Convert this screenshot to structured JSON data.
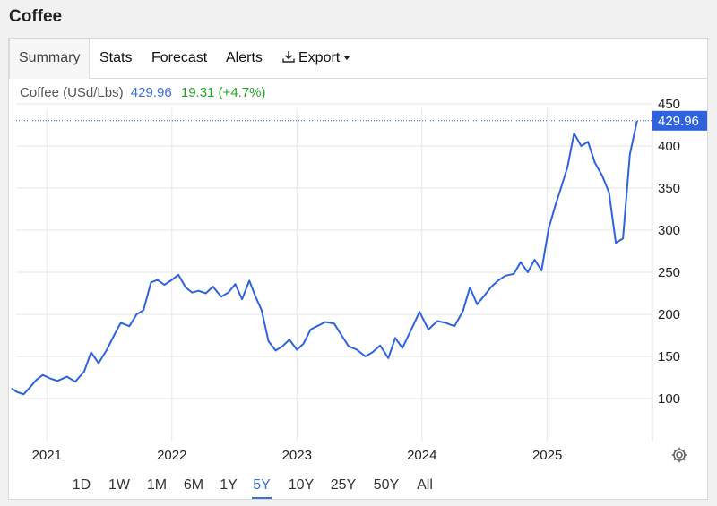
{
  "page": {
    "title": "Coffee"
  },
  "tabs": [
    {
      "label": "Summary",
      "active": true
    },
    {
      "label": "Stats"
    },
    {
      "label": "Forecast"
    },
    {
      "label": "Alerts"
    },
    {
      "label": "Export",
      "icon": "download-icon",
      "dropdown": true
    }
  ],
  "header": {
    "label": "Coffee (USd/Lbs)",
    "price": "429.96",
    "change": "19.31 (+4.7%)"
  },
  "ranges": [
    {
      "label": "1D"
    },
    {
      "label": "1W"
    },
    {
      "label": "1M"
    },
    {
      "label": "6M"
    },
    {
      "label": "1Y"
    },
    {
      "label": "5Y",
      "active": true
    },
    {
      "label": "10Y"
    },
    {
      "label": "25Y"
    },
    {
      "label": "50Y"
    },
    {
      "label": "All"
    }
  ],
  "colors": {
    "line": "#2f63de",
    "price_tag": "#2f63de",
    "change_positive": "#23a323",
    "grid": "#e6e6e6"
  },
  "settings_icon": "gear-icon",
  "chart_data": {
    "type": "line",
    "title": "",
    "xlabel": "",
    "ylabel": "",
    "x_ticks": [
      "2021",
      "2022",
      "2023",
      "2024",
      "2025"
    ],
    "y_ticks": [
      100,
      150,
      200,
      250,
      300,
      350,
      400,
      450
    ],
    "ylim": [
      50,
      455
    ],
    "xlim": [
      "2020-09-15",
      "2025-10-01"
    ],
    "grid": true,
    "last_value": "429.96",
    "series": [
      {
        "x": [
          "2020-09-20",
          "2020-10-05",
          "2020-10-25",
          "2020-11-10",
          "2020-12-01",
          "2020-12-20",
          "2021-01-10",
          "2021-02-01",
          "2021-03-01",
          "2021-03-25",
          "2021-04-20",
          "2021-05-10",
          "2021-06-01",
          "2021-06-25",
          "2021-07-20",
          "2021-08-05",
          "2021-08-30",
          "2021-09-20",
          "2021-10-10",
          "2021-11-01",
          "2021-11-20",
          "2021-12-10",
          "2022-01-01",
          "2022-01-20",
          "2022-02-10",
          "2022-03-01",
          "2022-03-20",
          "2022-04-10",
          "2022-05-01",
          "2022-05-25",
          "2022-06-15",
          "2022-07-05",
          "2022-07-25",
          "2022-08-15",
          "2022-09-01",
          "2022-09-20",
          "2022-10-10",
          "2022-10-31",
          "2022-11-20",
          "2022-12-10",
          "2023-01-01",
          "2023-01-20",
          "2023-02-10",
          "2023-03-01",
          "2023-03-25",
          "2023-04-20",
          "2023-05-10",
          "2023-06-01",
          "2023-06-25",
          "2023-07-20",
          "2023-08-10",
          "2023-09-01",
          "2023-09-25",
          "2023-10-15",
          "2023-11-05",
          "2023-12-01",
          "2023-12-25",
          "2024-01-20",
          "2024-02-15",
          "2024-03-10",
          "2024-04-05",
          "2024-04-30",
          "2024-05-20",
          "2024-06-10",
          "2024-07-01",
          "2024-07-20",
          "2024-08-10",
          "2024-09-01",
          "2024-09-25",
          "2024-10-15",
          "2024-11-05",
          "2024-11-25",
          "2024-12-15",
          "2025-01-05",
          "2025-01-25",
          "2025-02-10",
          "2025-03-01",
          "2025-03-20",
          "2025-04-10",
          "2025-04-30",
          "2025-05-20",
          "2025-06-10",
          "2025-06-30",
          "2025-07-20",
          "2025-08-10",
          "2025-08-30",
          "2025-09-20"
        ],
        "values": [
          112,
          108,
          105,
          112,
          122,
          128,
          124,
          121,
          126,
          120,
          132,
          155,
          142,
          158,
          178,
          190,
          186,
          200,
          205,
          238,
          241,
          235,
          241,
          247,
          232,
          226,
          228,
          225,
          233,
          221,
          226,
          236,
          218,
          240,
          222,
          205,
          168,
          157,
          162,
          170,
          158,
          165,
          182,
          186,
          191,
          189,
          176,
          162,
          158,
          150,
          155,
          163,
          148,
          172,
          160,
          182,
          203,
          182,
          192,
          190,
          186,
          204,
          232,
          212,
          222,
          232,
          240,
          246,
          248,
          262,
          250,
          265,
          252,
          302,
          330,
          350,
          375,
          415,
          400,
          405,
          380,
          365,
          345,
          285,
          290,
          390,
          430
        ]
      }
    ]
  }
}
